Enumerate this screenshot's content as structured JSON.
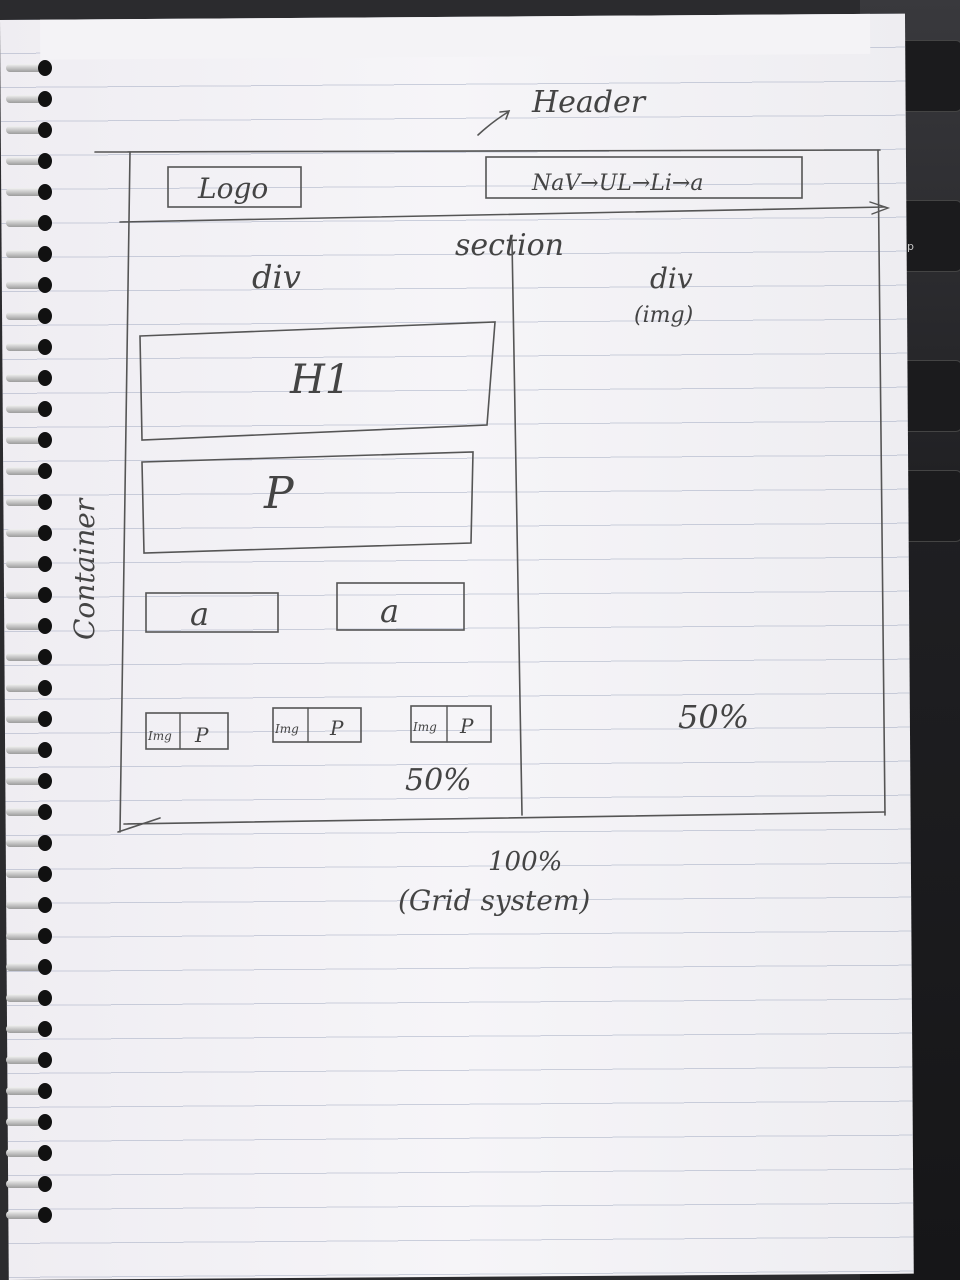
{
  "header": {
    "label": "Header",
    "logo": "Logo",
    "nav": "NaV→UL→Li→a"
  },
  "section": {
    "label": "section",
    "left": {
      "label": "div",
      "h1": "H1",
      "p": "P",
      "links": [
        "a",
        "a"
      ],
      "cards": [
        {
          "img": "Img",
          "p": "P"
        },
        {
          "img": "Img",
          "p": "P"
        },
        {
          "img": "Img",
          "p": "P"
        }
      ],
      "width": "50%"
    },
    "right": {
      "label": "div",
      "sublabel": "(img)",
      "width": "50%"
    }
  },
  "container": {
    "label": "Container"
  },
  "footer": {
    "width": "100%",
    "caption": "(Grid system)"
  },
  "desk": {
    "key_label": "up"
  }
}
